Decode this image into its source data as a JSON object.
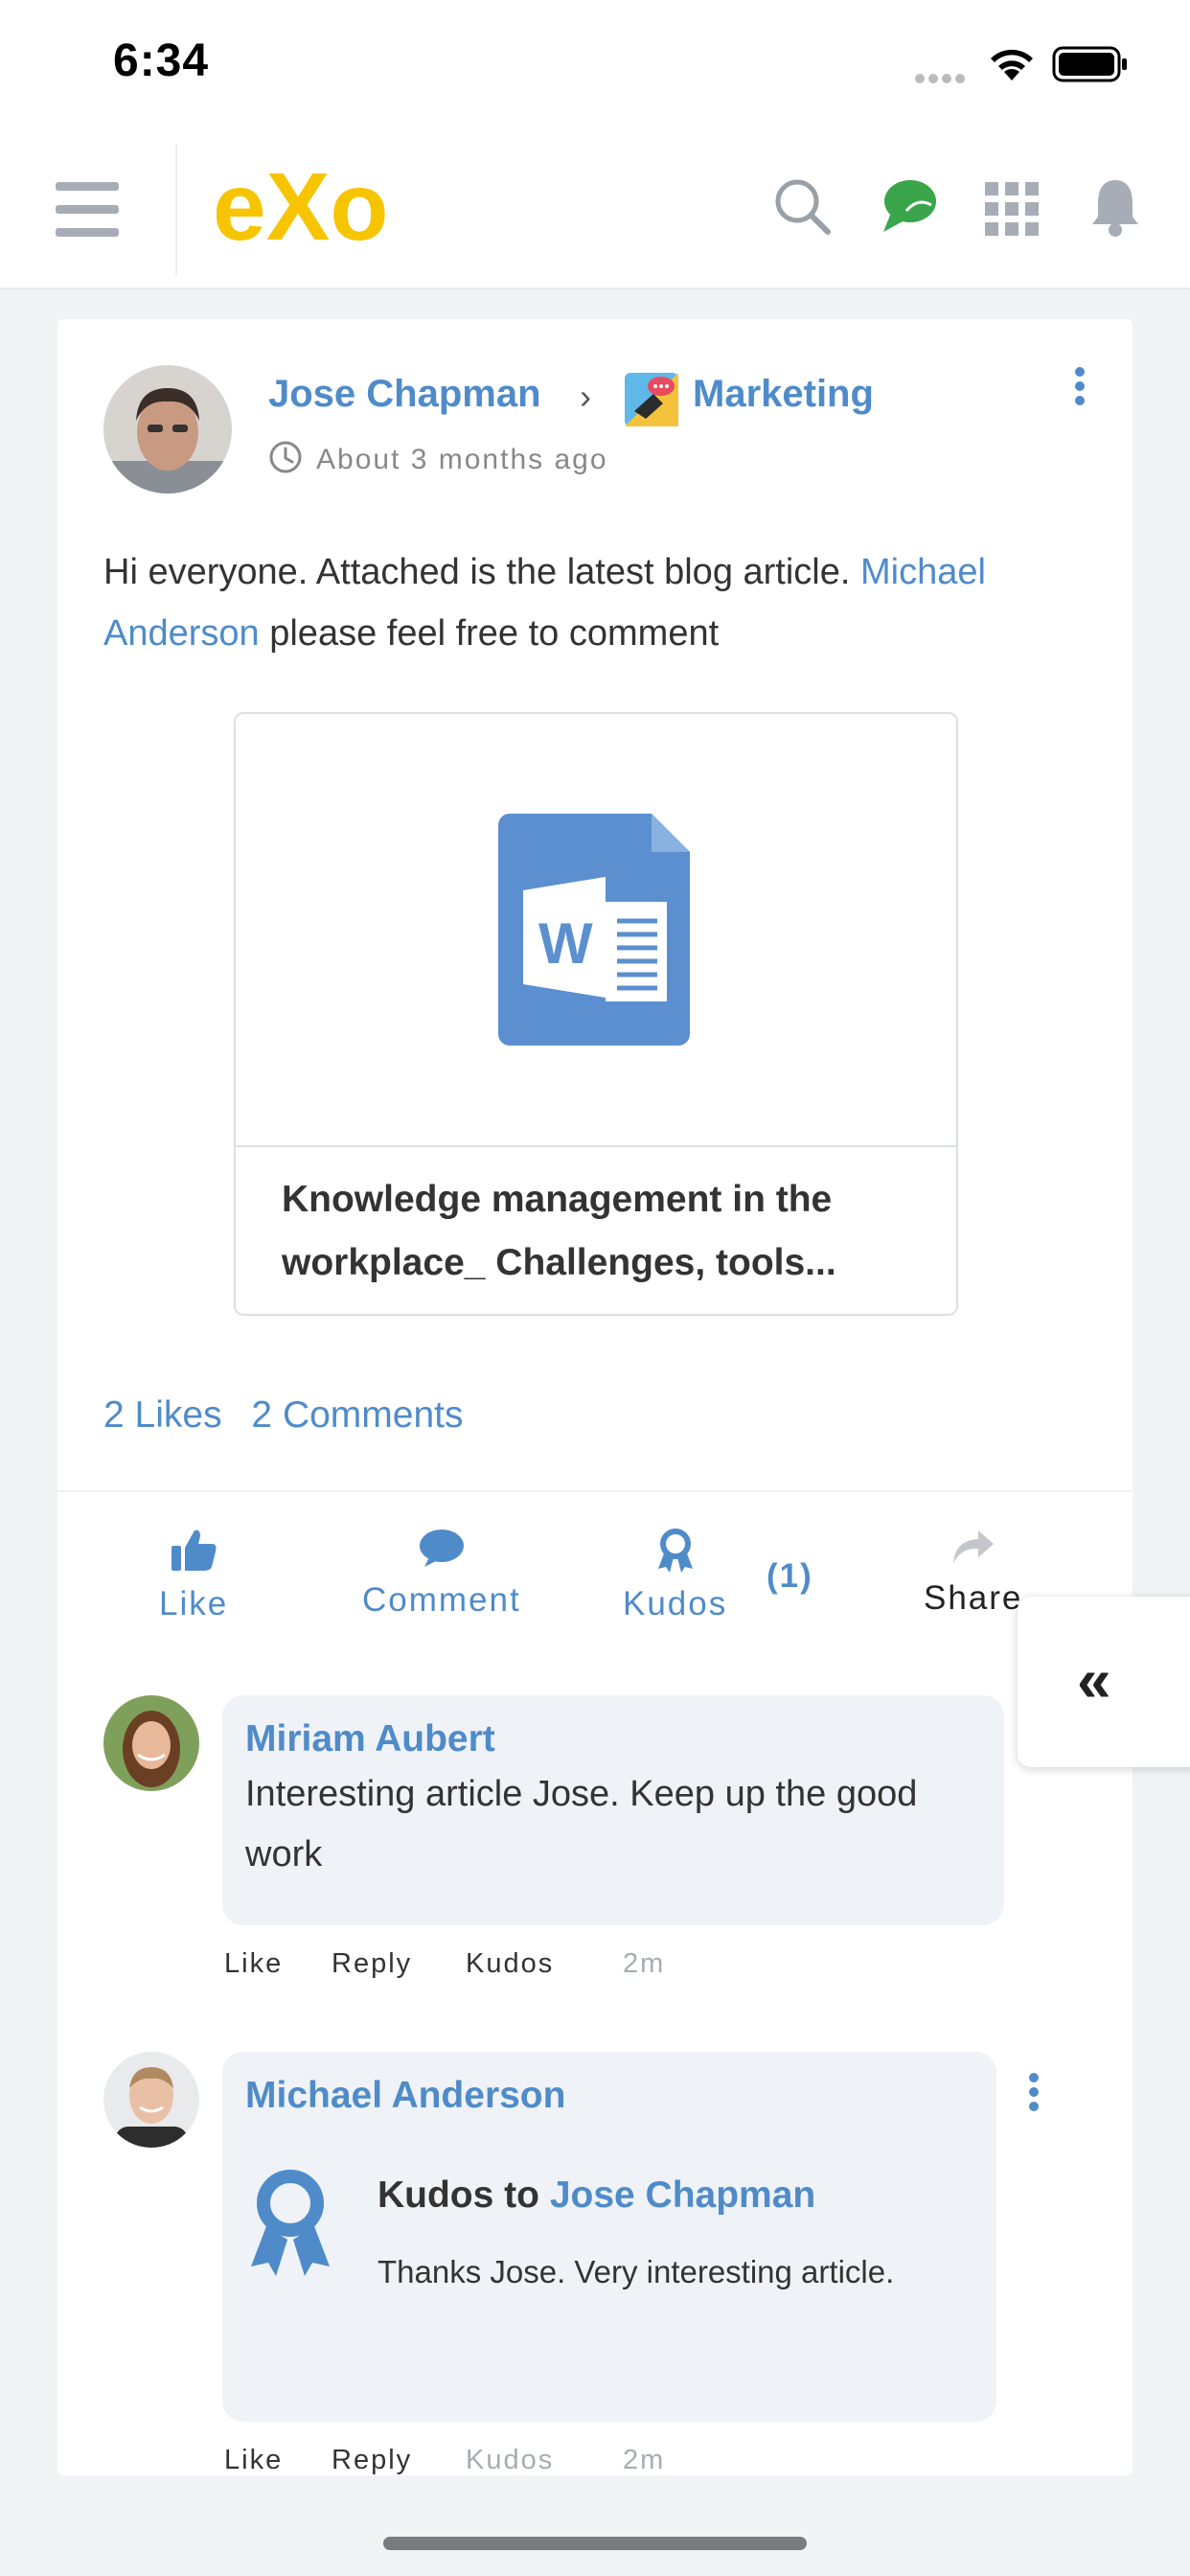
{
  "status_bar": {
    "time": "6:34"
  },
  "nav": {
    "logo_text": "eXo"
  },
  "post": {
    "author": "Jose Chapman",
    "space": "Marketing",
    "time_ago": "About 3 months ago",
    "text_before": "Hi everyone. Attached is the latest blog article. ",
    "mention": "Michael Anderson",
    "text_after": " please feel free to comment",
    "attachment": {
      "title_line1": "Knowledge management in the",
      "title_line2": "workplace_ Challenges, tools..."
    },
    "likes": "2 Likes",
    "comments": "2 Comments",
    "actions": {
      "like": "Like",
      "comment": "Comment",
      "kudos": "Kudos",
      "kudos_count": "(1)",
      "share": "Share"
    }
  },
  "comments": [
    {
      "author": "Miriam Aubert",
      "text": "Interesting article Jose. Keep up the good work",
      "like": "Like",
      "reply": "Reply",
      "kudos": "Kudos",
      "time": "2m"
    },
    {
      "author": "Michael Anderson",
      "kudos_prefix": "Kudos to ",
      "kudos_target": "Jose Chapman",
      "text": "Thanks Jose. Very interesting article.",
      "like": "Like",
      "reply": "Reply",
      "kudos": "Kudos",
      "time": "2m"
    }
  ],
  "colors": {
    "accent": "#4f8bc9",
    "logo_yellow": "#f7c400",
    "chat_green": "#3aa54a"
  }
}
